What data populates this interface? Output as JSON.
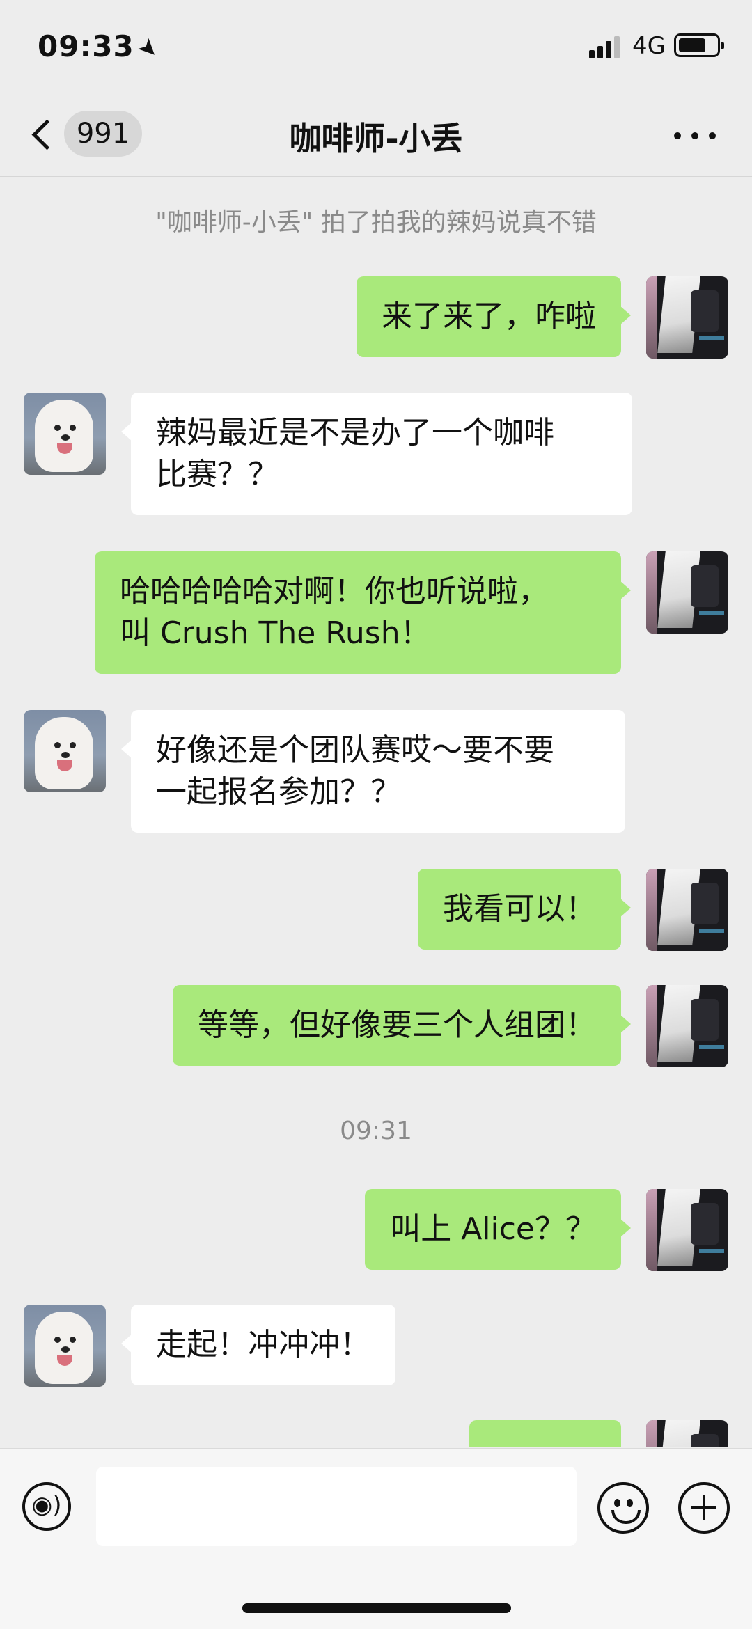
{
  "status_bar": {
    "time": "09:33",
    "network": "4G"
  },
  "nav": {
    "unread_count": "991",
    "title": "咖啡师-小丢"
  },
  "chat": {
    "system_notice": "\"咖啡师-小丢\" 拍了拍我的辣妈说真不错",
    "timestamp": "09:31",
    "messages": [
      {
        "from": "me",
        "lines": [
          "来了来了，咋啦"
        ]
      },
      {
        "from": "them",
        "lines": [
          "辣妈最近是不是办了一个咖啡",
          "比赛？？"
        ]
      },
      {
        "from": "me",
        "lines": [
          "哈哈哈哈哈对啊！你也听说啦，",
          "叫 Crush The Rush！"
        ]
      },
      {
        "from": "them",
        "lines": [
          "好像还是个团队赛哎～要不要",
          "一起报名参加？？"
        ]
      },
      {
        "from": "me",
        "lines": [
          "我看可以！"
        ]
      },
      {
        "from": "me",
        "lines": [
          "等等，但好像要三个人组团！"
        ]
      },
      {
        "from": "me",
        "lines": [
          "叫上 Alice？？"
        ]
      },
      {
        "from": "them",
        "lines": [
          "走起！冲冲冲！"
        ]
      }
    ]
  },
  "input_bar": {
    "value": ""
  },
  "colors": {
    "background": "#ededed",
    "my_bubble": "#a9e97b",
    "their_bubble": "#ffffff",
    "system_text": "#8a8a8a"
  },
  "icons": [
    "back-chevron-icon",
    "more-icon",
    "voice-icon",
    "emoji-icon",
    "plus-icon",
    "location-arrow-icon",
    "signal-icon",
    "battery-icon"
  ]
}
